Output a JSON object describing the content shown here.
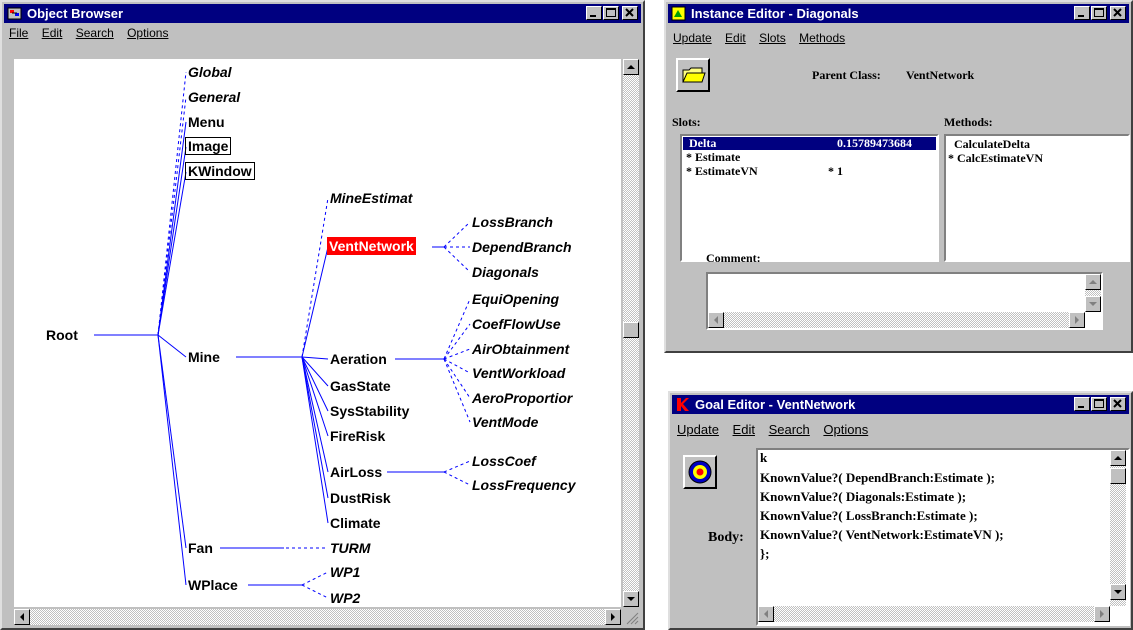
{
  "object_browser": {
    "title": "Object Browser",
    "menu": [
      "File",
      "Edit",
      "Search",
      "Options"
    ],
    "nodes": {
      "root": "Root",
      "global": "Global",
      "general": "General",
      "menu": "Menu",
      "image": "Image",
      "kwindow": "KWindow",
      "mine": "Mine",
      "fan": "Fan",
      "wplace": "WPlace",
      "mine_estimat": "MineEstimat",
      "vent_network": "VentNetwork",
      "aeration": "Aeration",
      "gas_state": "GasState",
      "sys_stability": "SysStability",
      "fire_risk": "FireRisk",
      "air_loss": "AirLoss",
      "dust_risk": "DustRisk",
      "climate": "Climate",
      "turm": "TURM",
      "wp1": "WP1",
      "wp2": "WP2",
      "loss_branch": "LossBranch",
      "depend_branch": "DependBranch",
      "diagonals": "Diagonals",
      "equi_opening": "EquiOpening",
      "coef_flow_use": "CoefFlowUse",
      "air_obtainment": "AirObtainment",
      "vent_workload": "VentWorkload",
      "aero_proportion": "AeroProportior",
      "vent_mode": "VentMode",
      "loss_coef": "LossCoef",
      "loss_frequency": "LossFrequency"
    }
  },
  "instance_editor": {
    "title": "Instance Editor - Diagonals",
    "menu": [
      "Update",
      "Edit",
      "Slots",
      "Methods"
    ],
    "parent_class_label": "Parent Class:",
    "parent_class_value": "VentNetwork",
    "slots_label": "Slots:",
    "methods_label": "Methods:",
    "slots": [
      {
        "name": "Delta",
        "value": "0.15789473684"
      },
      {
        "name": "* Estimate",
        "value": ""
      },
      {
        "name": "* EstimateVN",
        "value": "* 1"
      }
    ],
    "methods": [
      "CalculateDelta",
      "* CalcEstimateVN"
    ],
    "comment_label": "Comment:"
  },
  "goal_editor": {
    "title": "Goal Editor - VentNetwork",
    "menu": [
      "Update",
      "Edit",
      "Search",
      "Options"
    ],
    "body_label": "Body:",
    "body_lines": [
      "k",
      "KnownValue?( DependBranch:Estimate );",
      "KnownValue?( Diagonals:Estimate );",
      "KnownValue?( LossBranch:Estimate );",
      "KnownValue?( VentNetwork:EstimateVN );",
      "};"
    ]
  },
  "colors": {
    "title_bar": "#000080",
    "tree_line": "#0000ff",
    "selection": "#ff0000",
    "window_face": "#c0c0c0"
  }
}
